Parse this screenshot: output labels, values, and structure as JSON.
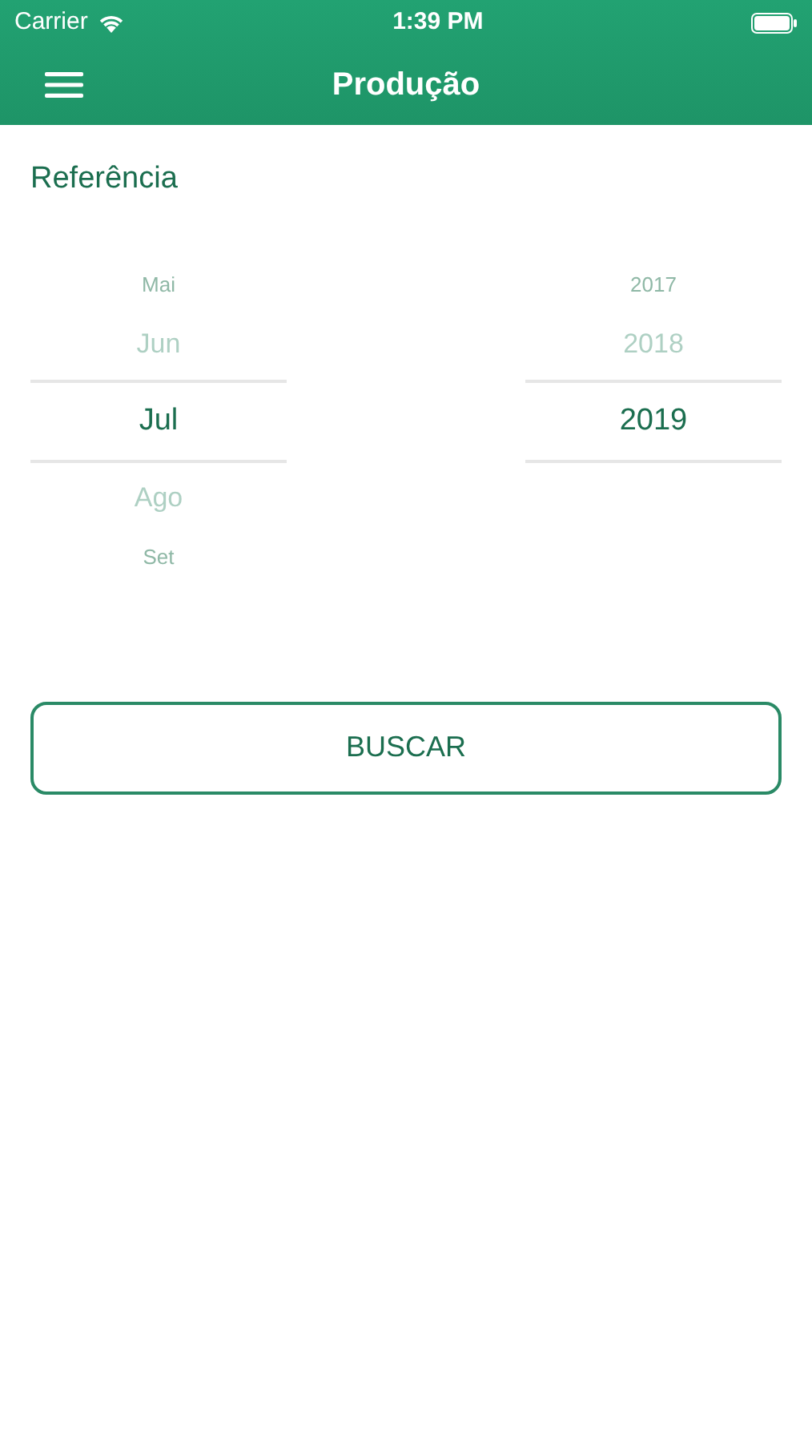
{
  "status_bar": {
    "carrier": "Carrier",
    "time": "1:39 PM"
  },
  "nav_bar": {
    "title": "Produção"
  },
  "section_label": "Referência",
  "pickers": [
    {
      "items": [
        {
          "label": "Mai",
          "selected": false
        },
        {
          "label": "Jun",
          "selected": false
        },
        {
          "label": "Jul",
          "selected": true
        },
        {
          "label": "Ago",
          "selected": false
        },
        {
          "label": "Set",
          "selected": false
        }
      ]
    },
    {
      "items": [
        {
          "label": "2017",
          "selected": false
        },
        {
          "label": "2018",
          "selected": false
        },
        {
          "label": "2019",
          "selected": true
        }
      ]
    }
  ],
  "search_button": "BUSCAR"
}
